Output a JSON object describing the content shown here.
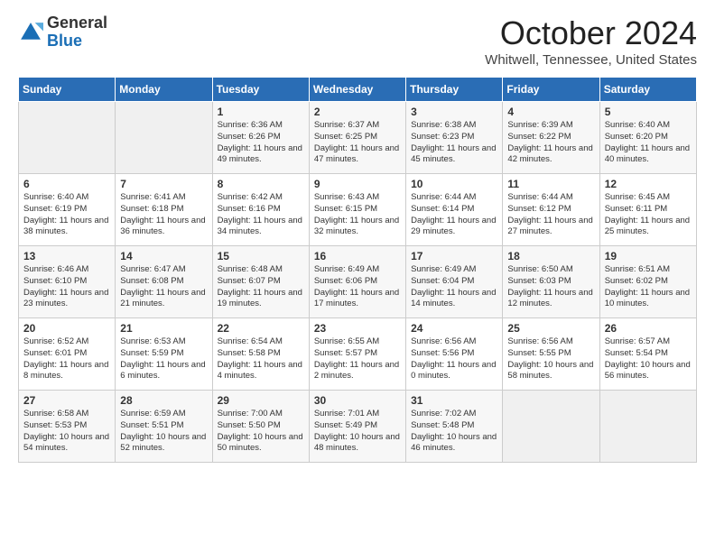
{
  "header": {
    "logo": {
      "general": "General",
      "blue": "Blue"
    },
    "month": "October 2024",
    "location": "Whitwell, Tennessee, United States"
  },
  "weekdays": [
    "Sunday",
    "Monday",
    "Tuesday",
    "Wednesday",
    "Thursday",
    "Friday",
    "Saturday"
  ],
  "weeks": [
    [
      {
        "num": "",
        "info": ""
      },
      {
        "num": "",
        "info": ""
      },
      {
        "num": "1",
        "info": "Sunrise: 6:36 AM\nSunset: 6:26 PM\nDaylight: 11 hours and 49 minutes."
      },
      {
        "num": "2",
        "info": "Sunrise: 6:37 AM\nSunset: 6:25 PM\nDaylight: 11 hours and 47 minutes."
      },
      {
        "num": "3",
        "info": "Sunrise: 6:38 AM\nSunset: 6:23 PM\nDaylight: 11 hours and 45 minutes."
      },
      {
        "num": "4",
        "info": "Sunrise: 6:39 AM\nSunset: 6:22 PM\nDaylight: 11 hours and 42 minutes."
      },
      {
        "num": "5",
        "info": "Sunrise: 6:40 AM\nSunset: 6:20 PM\nDaylight: 11 hours and 40 minutes."
      }
    ],
    [
      {
        "num": "6",
        "info": "Sunrise: 6:40 AM\nSunset: 6:19 PM\nDaylight: 11 hours and 38 minutes."
      },
      {
        "num": "7",
        "info": "Sunrise: 6:41 AM\nSunset: 6:18 PM\nDaylight: 11 hours and 36 minutes."
      },
      {
        "num": "8",
        "info": "Sunrise: 6:42 AM\nSunset: 6:16 PM\nDaylight: 11 hours and 34 minutes."
      },
      {
        "num": "9",
        "info": "Sunrise: 6:43 AM\nSunset: 6:15 PM\nDaylight: 11 hours and 32 minutes."
      },
      {
        "num": "10",
        "info": "Sunrise: 6:44 AM\nSunset: 6:14 PM\nDaylight: 11 hours and 29 minutes."
      },
      {
        "num": "11",
        "info": "Sunrise: 6:44 AM\nSunset: 6:12 PM\nDaylight: 11 hours and 27 minutes."
      },
      {
        "num": "12",
        "info": "Sunrise: 6:45 AM\nSunset: 6:11 PM\nDaylight: 11 hours and 25 minutes."
      }
    ],
    [
      {
        "num": "13",
        "info": "Sunrise: 6:46 AM\nSunset: 6:10 PM\nDaylight: 11 hours and 23 minutes."
      },
      {
        "num": "14",
        "info": "Sunrise: 6:47 AM\nSunset: 6:08 PM\nDaylight: 11 hours and 21 minutes."
      },
      {
        "num": "15",
        "info": "Sunrise: 6:48 AM\nSunset: 6:07 PM\nDaylight: 11 hours and 19 minutes."
      },
      {
        "num": "16",
        "info": "Sunrise: 6:49 AM\nSunset: 6:06 PM\nDaylight: 11 hours and 17 minutes."
      },
      {
        "num": "17",
        "info": "Sunrise: 6:49 AM\nSunset: 6:04 PM\nDaylight: 11 hours and 14 minutes."
      },
      {
        "num": "18",
        "info": "Sunrise: 6:50 AM\nSunset: 6:03 PM\nDaylight: 11 hours and 12 minutes."
      },
      {
        "num": "19",
        "info": "Sunrise: 6:51 AM\nSunset: 6:02 PM\nDaylight: 11 hours and 10 minutes."
      }
    ],
    [
      {
        "num": "20",
        "info": "Sunrise: 6:52 AM\nSunset: 6:01 PM\nDaylight: 11 hours and 8 minutes."
      },
      {
        "num": "21",
        "info": "Sunrise: 6:53 AM\nSunset: 5:59 PM\nDaylight: 11 hours and 6 minutes."
      },
      {
        "num": "22",
        "info": "Sunrise: 6:54 AM\nSunset: 5:58 PM\nDaylight: 11 hours and 4 minutes."
      },
      {
        "num": "23",
        "info": "Sunrise: 6:55 AM\nSunset: 5:57 PM\nDaylight: 11 hours and 2 minutes."
      },
      {
        "num": "24",
        "info": "Sunrise: 6:56 AM\nSunset: 5:56 PM\nDaylight: 11 hours and 0 minutes."
      },
      {
        "num": "25",
        "info": "Sunrise: 6:56 AM\nSunset: 5:55 PM\nDaylight: 10 hours and 58 minutes."
      },
      {
        "num": "26",
        "info": "Sunrise: 6:57 AM\nSunset: 5:54 PM\nDaylight: 10 hours and 56 minutes."
      }
    ],
    [
      {
        "num": "27",
        "info": "Sunrise: 6:58 AM\nSunset: 5:53 PM\nDaylight: 10 hours and 54 minutes."
      },
      {
        "num": "28",
        "info": "Sunrise: 6:59 AM\nSunset: 5:51 PM\nDaylight: 10 hours and 52 minutes."
      },
      {
        "num": "29",
        "info": "Sunrise: 7:00 AM\nSunset: 5:50 PM\nDaylight: 10 hours and 50 minutes."
      },
      {
        "num": "30",
        "info": "Sunrise: 7:01 AM\nSunset: 5:49 PM\nDaylight: 10 hours and 48 minutes."
      },
      {
        "num": "31",
        "info": "Sunrise: 7:02 AM\nSunset: 5:48 PM\nDaylight: 10 hours and 46 minutes."
      },
      {
        "num": "",
        "info": ""
      },
      {
        "num": "",
        "info": ""
      }
    ]
  ]
}
